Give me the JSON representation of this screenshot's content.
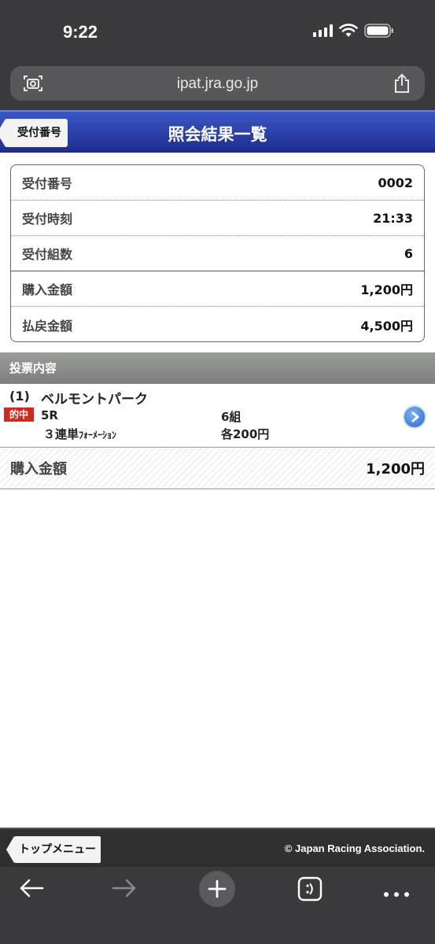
{
  "status": {
    "time": "9:22"
  },
  "browser": {
    "url": "ipat.jra.go.jp"
  },
  "header": {
    "back_label": "受付番号",
    "title": "照会結果一覧"
  },
  "summary": [
    {
      "label": "受付番号",
      "value": "0002"
    },
    {
      "label": "受付時刻",
      "value": "21:33"
    },
    {
      "label": "受付組数",
      "value": "6"
    },
    {
      "label": "購入金額",
      "value": "1,200円"
    },
    {
      "label": "払戻金額",
      "value": "4,500円"
    }
  ],
  "section": {
    "title": "投票内容"
  },
  "bet": {
    "index": "(1)",
    "venue": "ベルモントパーク",
    "badge": "的中",
    "race": "5R",
    "bet_count": "6組",
    "type_main": "３連単",
    "type_sub": "ﾌｫｰﾒｰｼｮﾝ",
    "unit": "各200円"
  },
  "total": {
    "label": "購入金額",
    "value": "1,200円"
  },
  "footer": {
    "top_menu_label": "トップメニュー",
    "copyright": "© Japan Racing Association."
  },
  "icons": {
    "camera": "camera-scan-icon",
    "share": "share-icon",
    "back": "arrow-left-icon",
    "forward": "arrow-right-icon",
    "new_tab": "plus-icon",
    "tabs": "tabs-icon",
    "more": "more-icon"
  },
  "colors": {
    "header_blue": "#2a3fae",
    "badge_red": "#d42a1e",
    "section_gray": "#8b8d8b"
  }
}
